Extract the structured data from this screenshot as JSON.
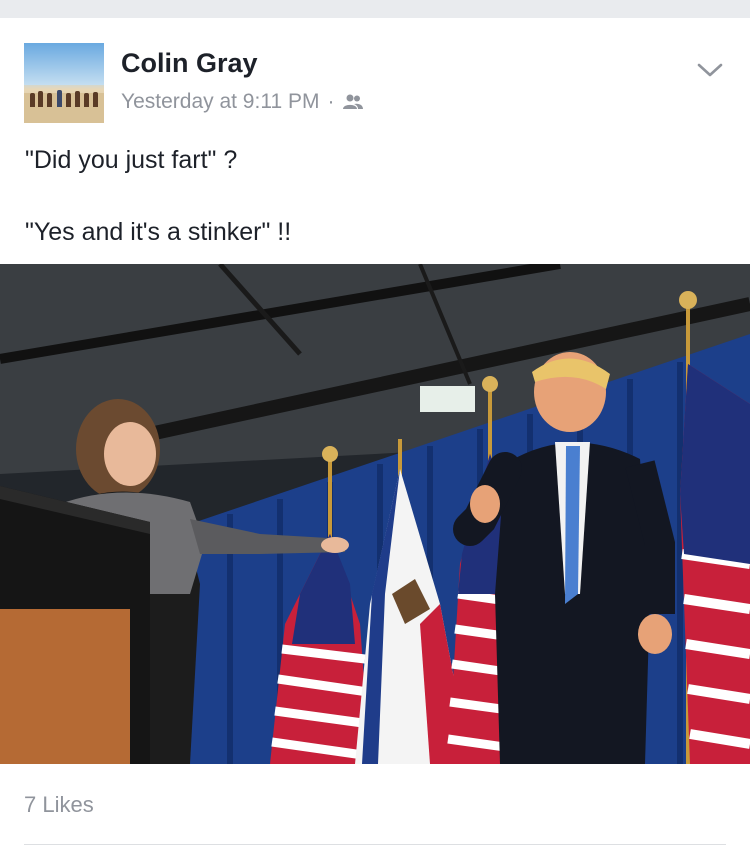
{
  "post": {
    "author": "Colin Gray",
    "timestamp": "Yesterday at 9:11 PM",
    "separator": "·",
    "audience_icon": "friends-icon",
    "menu_icon": "chevron-down-icon",
    "lines": [
      "\"Did you just fart\" ?",
      "\"Yes and it's a stinker\" !!"
    ],
    "likes": "7 Likes"
  },
  "colors": {
    "text": "#1d2129",
    "meta": "#90949c",
    "divider": "#dddfe2"
  }
}
